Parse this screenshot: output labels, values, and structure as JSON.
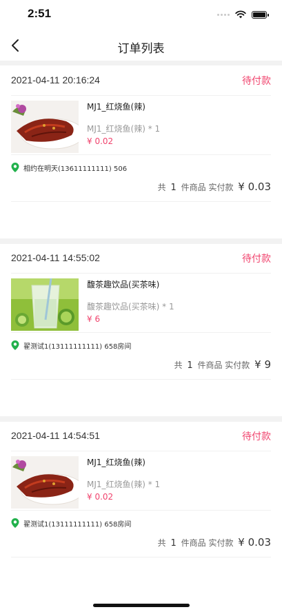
{
  "status_bar": {
    "time": "2:51"
  },
  "nav": {
    "title": "订单列表"
  },
  "colors": {
    "accent": "#f0436d",
    "pin": "#22b14c"
  },
  "orders": [
    {
      "datetime": "2021-04-11 20:16:24",
      "status": "待付款",
      "product_name": "MJ1_红烧鱼(辣)",
      "spec": "MJ1_红烧鱼(辣) * 1",
      "price": "¥ 0.02",
      "image": "red-braised-fish",
      "address": "相约在明天(13611111111) 506",
      "summary_prefix": "共",
      "count": "1",
      "summary_mid": "件商品 实付款",
      "total": "¥ 0.03"
    },
    {
      "datetime": "2021-04-11 14:55:02",
      "status": "待付款",
      "product_name": "馥茶趣饮品(买茶味)",
      "spec": "馥茶趣饮品(买茶味) * 1",
      "price": "¥ 6",
      "image": "lime-drink",
      "address": "翟测试1(13111111111) 658房间",
      "summary_prefix": "共",
      "count": "1",
      "summary_mid": "件商品 实付款",
      "total": "¥ 9"
    },
    {
      "datetime": "2021-04-11 14:54:51",
      "status": "待付款",
      "product_name": "MJ1_红烧鱼(辣)",
      "spec": "MJ1_红烧鱼(辣) * 1",
      "price": "¥ 0.02",
      "image": "red-braised-fish",
      "address": "翟测试1(13111111111) 658房间",
      "summary_prefix": "共",
      "count": "1",
      "summary_mid": "件商品 实付款",
      "total": "¥ 0.03"
    }
  ]
}
